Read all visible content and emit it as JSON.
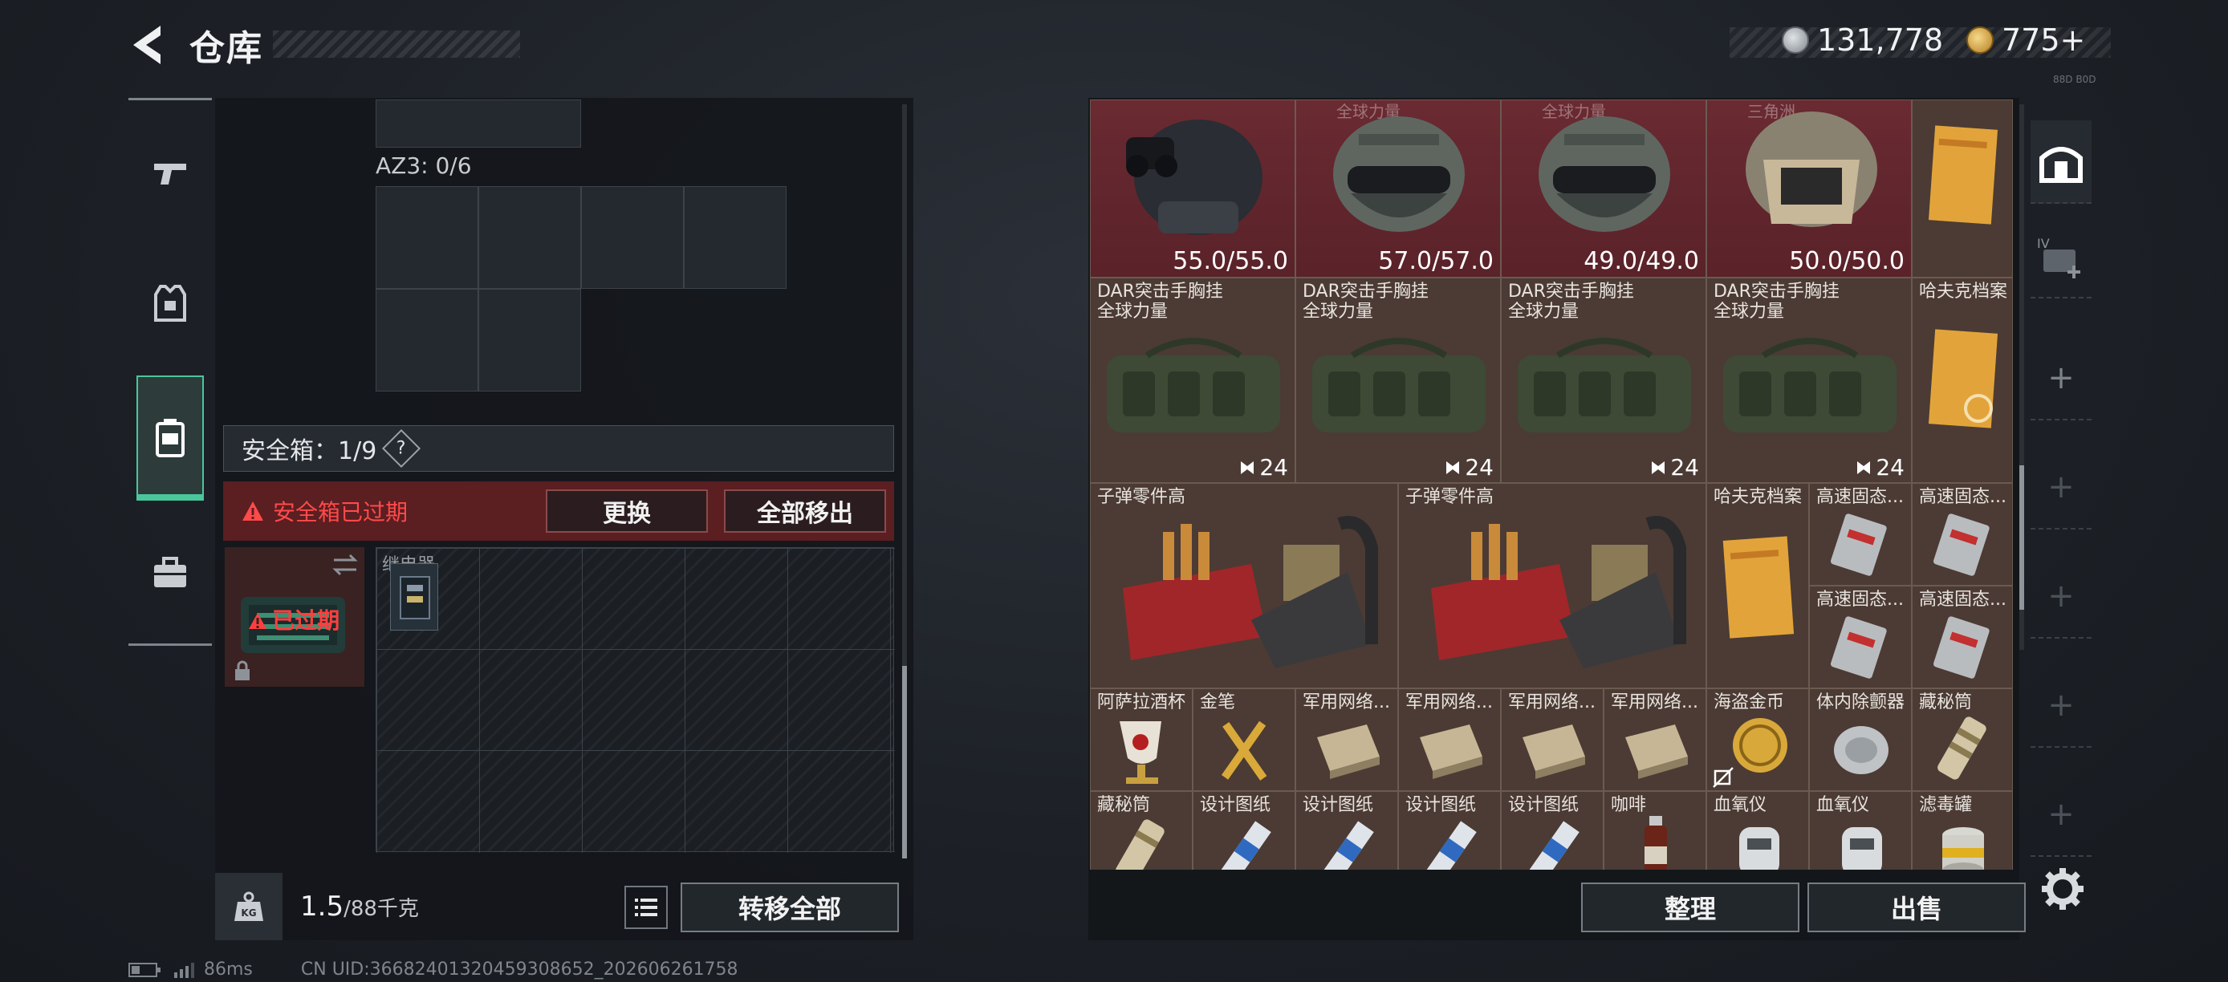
{
  "header": {
    "title": "仓库",
    "currency_silver": "131,778",
    "currency_gold": "775+",
    "tiny_tag": "88D B0D"
  },
  "left_tabs": [
    "gun-icon",
    "vest-icon",
    "safe-case-icon",
    "briefcase-icon"
  ],
  "loadout": {
    "az3_label": "AZ3: 0/6",
    "safe_box_label": "安全箱：1/9",
    "help_glyph": "?",
    "expired_notice": "安全箱已过期",
    "replace_button": "更换",
    "remove_all_button": "全部移出",
    "case_expired_label": "已过期",
    "relay_label": "继电器"
  },
  "bottom_left": {
    "weight_value": "1.5",
    "weight_max": "/88千克",
    "weight_icon_text": "KG",
    "transfer_all_button": "转移全部"
  },
  "stash": {
    "helmets": [
      {
        "name": "",
        "value": "55.0/55.0"
      },
      {
        "name": "全球力量",
        "value": "57.0/57.0"
      },
      {
        "name": "全球力量",
        "value": "49.0/49.0"
      },
      {
        "name": "三角洲",
        "value": "50.0/50.0"
      }
    ],
    "bags": [
      {
        "name": "DAR突击手胸挂\n全球力量",
        "count": "24"
      },
      {
        "name": "DAR突击手胸挂\n全球力量",
        "count": "24"
      },
      {
        "name": "DAR突击手胸挂\n全球力量",
        "count": "24"
      },
      {
        "name": "DAR突击手胸挂\n全球力量",
        "count": "24"
      }
    ],
    "ammo_parts": [
      {
        "name": "子弹零件高"
      },
      {
        "name": "子弹零件高"
      }
    ],
    "small_items": {
      "hafu_1": "哈夫克档案",
      "hafu_2": "哈夫克档案",
      "ssd_1": "高速固态...",
      "ssd_2": "高速固态...",
      "ssd_3": "高速固态...",
      "ssd_4": "高速固态...",
      "row4": [
        "阿萨拉酒杯",
        "金笔",
        "军用网络...",
        "军用网络...",
        "军用网络...",
        "军用网络...",
        "海盗金币",
        "体内除颤器",
        "藏秘筒"
      ],
      "row5": [
        "藏秘筒",
        "设计图纸",
        "设计图纸",
        "设计图纸",
        "设计图纸",
        "咖啡",
        "血氧仪",
        "血氧仪",
        "滤毒罐"
      ]
    },
    "sort_button": "整理",
    "sell_button": "出售"
  },
  "right_tabs": {
    "tab2_label": "IV"
  },
  "status_bar": {
    "ping": "86ms",
    "uid": "CN UID:3668240132045930865​2_202606261758"
  },
  "colors": {
    "accent_green": "#49c79b",
    "expired_red": "#ff4a4a",
    "red_cell": "#6a2a32",
    "brown_cell": "#4b3b34"
  }
}
